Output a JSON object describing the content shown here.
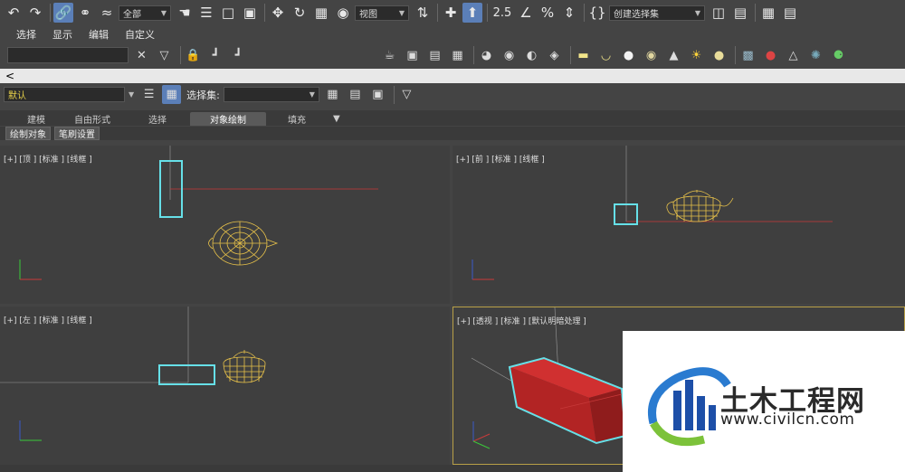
{
  "toolbar": {
    "selection_filter": "全部",
    "ref_coord": "视图",
    "snap_label": "2.5",
    "named_selection": "创建选择集"
  },
  "menu": {
    "items": [
      "选择",
      "显示",
      "编辑",
      "自定义"
    ]
  },
  "command_line": {
    "prompt": "<"
  },
  "layer_bar": {
    "layer_value": "默认",
    "selection_set_label": "选择集:",
    "selection_set_value": ""
  },
  "ribbon": {
    "tabs": [
      "建模",
      "自由形式",
      "选择",
      "对象绘制",
      "填充"
    ],
    "active_tab": "对象绘制",
    "sub_buttons": [
      "绘制对象",
      "笔刷设置"
    ]
  },
  "viewports": {
    "top": {
      "label": "[+] [顶 ] [标准 ] [线框 ]"
    },
    "front": {
      "label": "[+] [前 ] [标准 ] [线框 ]"
    },
    "left": {
      "label": "[+] [左 ] [标准 ] [线框 ]"
    },
    "perspective": {
      "label": "[+] [透视 ] [标准 ] [默认明暗处理 ]"
    }
  },
  "axis": {
    "x": "x",
    "y": "y",
    "z": "z"
  },
  "watermark": {
    "title": "土木工程网",
    "url": "www.civilcn.com"
  },
  "colors": {
    "selection": "#66e0e8",
    "teapot": "#e8c24a",
    "box_red": "#c42525",
    "axis_x": "#c83a3a",
    "axis_y": "#3ac83a",
    "axis_z": "#3a5ac8",
    "active_viewport": "#b8a047"
  }
}
